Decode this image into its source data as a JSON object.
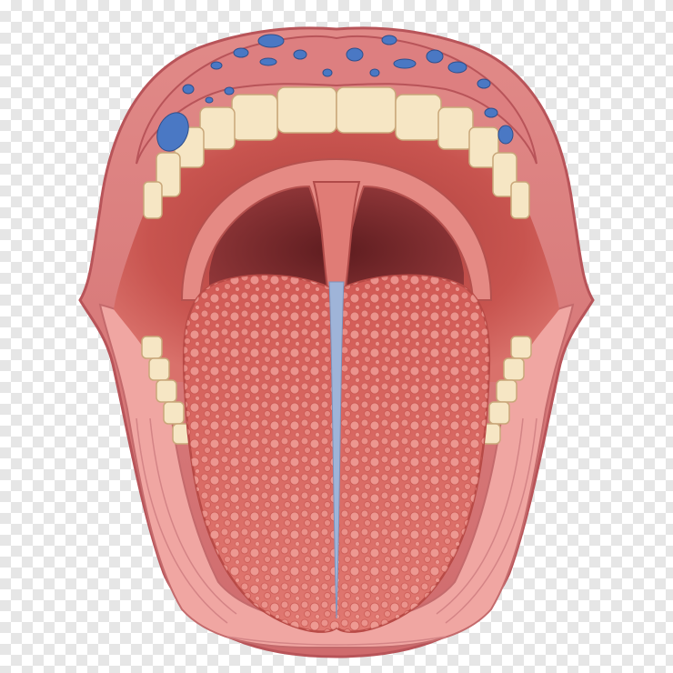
{
  "image": {
    "subject": "mouth-tongue-illustration",
    "background": "transparency-checkerboard",
    "colors": {
      "checker_light": "#ffffff",
      "checker_dark": "#e6e6e6",
      "lip_outer": "#d9787a",
      "lip_highlight": "#f4a7a2",
      "mouth_interior": "#c8544f",
      "throat_dark": "#7e2a2c",
      "tongue": "#d8625c",
      "tongue_bumps": "#f0a19a",
      "teeth": "#f6e6c4",
      "blue_spots": "#4a78c4",
      "tongue_midline": "#9fb4d8"
    }
  }
}
